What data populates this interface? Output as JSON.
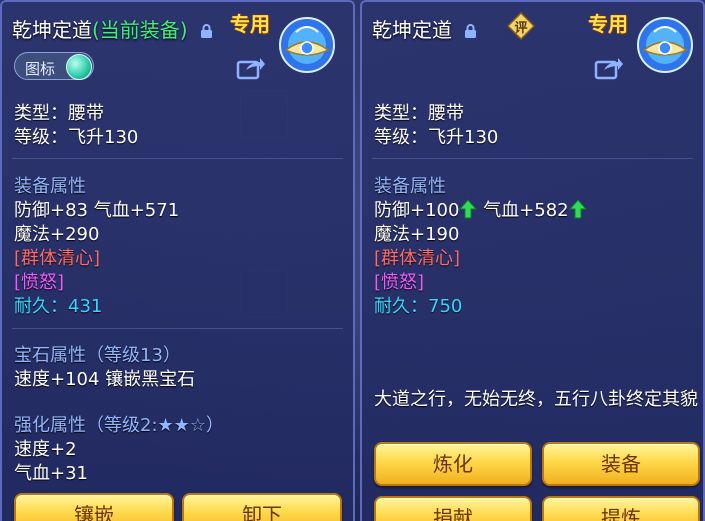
{
  "left": {
    "title_main": "乾坤定道",
    "title_sub": "(当前装备)",
    "exclusive": "专用",
    "toggle_label": "图标",
    "type": "类型：腰带",
    "level": "等级：飞升130",
    "attr_header": "装备属性",
    "attr_line1": "防御+83 气血+571",
    "attr_line2": "魔法+290",
    "skill1": "[群体清心]",
    "skill2": "[愤怒]",
    "durability": "耐久：431",
    "gem_header": "宝石属性（等级13）",
    "gem_line": "速度+104 镶嵌黑宝石",
    "enhance_header": "强化属性（等级2:★★☆）",
    "enhance_line1": "速度+2",
    "enhance_line2": "气血+31",
    "btn_inlay": "镶嵌",
    "btn_unequip": "卸下"
  },
  "right": {
    "title_main": "乾坤定道",
    "rate_icon_text": "评",
    "exclusive": "专用",
    "type": "类型：腰带",
    "level": "等级：飞升130",
    "attr_header": "装备属性",
    "attr_def": "防御+100",
    "attr_hp": "气血+582",
    "attr_line2": "魔法+190",
    "skill1": "[群体清心]",
    "skill2": "[愤怒]",
    "durability": "耐久：750",
    "description": "大道之行，无始无终，五行八卦终定其貌",
    "btn_refine": "炼化",
    "btn_equip": "装备",
    "btn_donate": "捐献",
    "btn_extract": "提炼"
  },
  "colors": {
    "title_green": "#3cf07a",
    "header_blue": "#90b6ff",
    "skill_red": "#ff6a6a",
    "skill_purple": "#ee5cff",
    "durability_cyan": "#34d7ff",
    "exclusive_gold": "#ffe24a",
    "button_gold": "#ffd84a",
    "upgrade_arrow_green": "#2fdc5a"
  }
}
